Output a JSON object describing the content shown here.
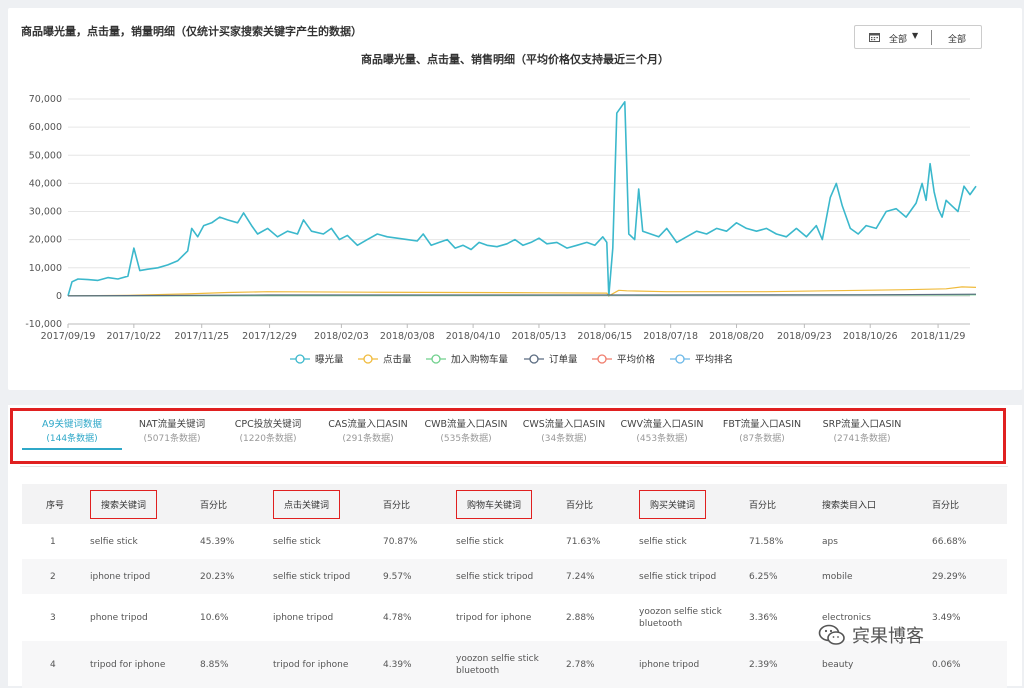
{
  "panel": {
    "title": "商品曝光量，点击量，销量明细（仅统计买家搜索关键字产生的数据）",
    "date_picker": {
      "value": "全部",
      "value2": "全部"
    }
  },
  "chart_data": {
    "type": "line",
    "title": "商品曝光量、点击量、销售明细（平均价格仅支持最近三个月）",
    "x_ticks": [
      "2017/09/19",
      "2017/10/22",
      "2017/11/25",
      "2017/12/29",
      "2018/02/03",
      "2018/03/08",
      "2018/04/10",
      "2018/05/13",
      "2018/06/15",
      "2018/07/18",
      "2018/08/20",
      "2018/09/23",
      "2018/10/26",
      "2018/11/29"
    ],
    "x_range": [
      "2017/09/19",
      "2018/12/15"
    ],
    "y_ticks": [
      "70,000",
      "60,000",
      "50,000",
      "40,000",
      "30,000",
      "20,000",
      "10,000",
      "0",
      "-10,000"
    ],
    "ylim": [
      -10000,
      70000
    ],
    "grid": true,
    "legend_position": "bottom",
    "series": [
      {
        "name": "曝光量",
        "color": "#3bb8cc",
        "points": [
          [
            0,
            0
          ],
          [
            2,
            5000
          ],
          [
            5,
            6000
          ],
          [
            10,
            5800
          ],
          [
            15,
            5500
          ],
          [
            20,
            6500
          ],
          [
            25,
            6000
          ],
          [
            30,
            7000
          ],
          [
            33,
            17000
          ],
          [
            36,
            9000
          ],
          [
            40,
            9500
          ],
          [
            45,
            10000
          ],
          [
            50,
            11000
          ],
          [
            55,
            12500
          ],
          [
            60,
            16000
          ],
          [
            62,
            24000
          ],
          [
            65,
            21000
          ],
          [
            68,
            25000
          ],
          [
            72,
            26000
          ],
          [
            76,
            28000
          ],
          [
            80,
            27000
          ],
          [
            85,
            26000
          ],
          [
            88,
            29500
          ],
          [
            92,
            25000
          ],
          [
            95,
            22000
          ],
          [
            100,
            24000
          ],
          [
            105,
            21000
          ],
          [
            110,
            23000
          ],
          [
            115,
            22000
          ],
          [
            118,
            27000
          ],
          [
            122,
            23000
          ],
          [
            128,
            22000
          ],
          [
            132,
            24000
          ],
          [
            136,
            20000
          ],
          [
            140,
            21500
          ],
          [
            145,
            18000
          ],
          [
            150,
            20000
          ],
          [
            155,
            22000
          ],
          [
            160,
            21000
          ],
          [
            165,
            20500
          ],
          [
            170,
            20000
          ],
          [
            175,
            19500
          ],
          [
            178,
            22000
          ],
          [
            182,
            18000
          ],
          [
            186,
            19000
          ],
          [
            190,
            20000
          ],
          [
            194,
            17000
          ],
          [
            198,
            18000
          ],
          [
            202,
            16500
          ],
          [
            206,
            19000
          ],
          [
            210,
            18000
          ],
          [
            215,
            17500
          ],
          [
            220,
            18500
          ],
          [
            224,
            20000
          ],
          [
            228,
            18000
          ],
          [
            232,
            19000
          ],
          [
            236,
            20500
          ],
          [
            240,
            18500
          ],
          [
            245,
            19000
          ],
          [
            250,
            17000
          ],
          [
            255,
            18000
          ],
          [
            260,
            19000
          ],
          [
            264,
            18000
          ],
          [
            268,
            21000
          ],
          [
            270,
            19000
          ],
          [
            271,
            0
          ],
          [
            273,
            17000
          ],
          [
            275,
            65000
          ],
          [
            277,
            67000
          ],
          [
            279,
            69000
          ],
          [
            281,
            22000
          ],
          [
            284,
            20000
          ],
          [
            286,
            38000
          ],
          [
            288,
            23000
          ],
          [
            292,
            22000
          ],
          [
            296,
            21000
          ],
          [
            300,
            24000
          ],
          [
            305,
            19000
          ],
          [
            310,
            21000
          ],
          [
            315,
            23000
          ],
          [
            320,
            22000
          ],
          [
            325,
            24000
          ],
          [
            330,
            23000
          ],
          [
            335,
            26000
          ],
          [
            340,
            24000
          ],
          [
            345,
            23000
          ],
          [
            350,
            24000
          ],
          [
            355,
            22000
          ],
          [
            360,
            21000
          ],
          [
            365,
            24000
          ],
          [
            370,
            21000
          ],
          [
            375,
            25000
          ],
          [
            378,
            20000
          ],
          [
            382,
            35000
          ],
          [
            385,
            40000
          ],
          [
            388,
            32000
          ],
          [
            392,
            24000
          ],
          [
            396,
            22000
          ],
          [
            400,
            25000
          ],
          [
            405,
            24000
          ],
          [
            410,
            30000
          ],
          [
            415,
            31000
          ],
          [
            420,
            28000
          ],
          [
            425,
            33000
          ],
          [
            428,
            40000
          ],
          [
            430,
            34000
          ],
          [
            432,
            47000
          ],
          [
            434,
            37000
          ],
          [
            436,
            31000
          ],
          [
            438,
            28000
          ],
          [
            440,
            34000
          ],
          [
            443,
            32000
          ],
          [
            446,
            30000
          ],
          [
            449,
            39000
          ],
          [
            452,
            36000
          ],
          [
            454,
            38000
          ],
          [
            455,
            39000
          ]
        ]
      },
      {
        "name": "点击量",
        "color": "#f0bb3c",
        "points": [
          [
            0,
            0
          ],
          [
            30,
            200
          ],
          [
            60,
            700
          ],
          [
            80,
            1200
          ],
          [
            100,
            1500
          ],
          [
            150,
            1300
          ],
          [
            200,
            1200
          ],
          [
            240,
            1100
          ],
          [
            270,
            1000
          ],
          [
            271,
            0
          ],
          [
            276,
            2000
          ],
          [
            280,
            1800
          ],
          [
            300,
            1500
          ],
          [
            350,
            1500
          ],
          [
            380,
            1800
          ],
          [
            420,
            2200
          ],
          [
            440,
            2500
          ],
          [
            448,
            3200
          ],
          [
            455,
            3000
          ]
        ]
      },
      {
        "name": "加入购物车量",
        "color": "#6fd08c",
        "points": [
          [
            0,
            0
          ],
          [
            455,
            400
          ]
        ]
      },
      {
        "name": "订单量",
        "color": "#5a6b80",
        "points": [
          [
            0,
            0
          ],
          [
            100,
            300
          ],
          [
            200,
            300
          ],
          [
            300,
            300
          ],
          [
            400,
            400
          ],
          [
            455,
            600
          ]
        ]
      },
      {
        "name": "平均价格",
        "color": "#f07c6c",
        "points": []
      },
      {
        "name": "平均排名",
        "color": "#6bb8e8",
        "points": []
      }
    ]
  },
  "tabs": [
    {
      "label": "A9关键词数据",
      "sub": "(144条数据)"
    },
    {
      "label": "NAT流量关键词",
      "sub": "(5071条数据)"
    },
    {
      "label": "CPC投放关键词",
      "sub": "(1220条数据)"
    },
    {
      "label": "CAS流量入口ASIN",
      "sub": "(291条数据)"
    },
    {
      "label": "CWB流量入口ASIN",
      "sub": "(535条数据)"
    },
    {
      "label": "CWS流量入口ASIN",
      "sub": "(34条数据)"
    },
    {
      "label": "CWV流量入口ASIN",
      "sub": "(453条数据)"
    },
    {
      "label": "FBT流量入口ASIN",
      "sub": "(87条数据)"
    },
    {
      "label": "SRP流量入口ASIN",
      "sub": "(2741条数据)"
    }
  ],
  "table": {
    "headers": [
      "序号",
      "搜索关键词",
      "百分比",
      "点击关键词",
      "百分比",
      "购物车关键词",
      "百分比",
      "购买关键词",
      "百分比",
      "搜索类目入口",
      "百分比"
    ],
    "rows": [
      [
        "1",
        "selfie stick",
        "45.39%",
        "selfie stick",
        "70.87%",
        "selfie stick",
        "71.63%",
        "selfie stick",
        "71.58%",
        "aps",
        "66.68%"
      ],
      [
        "2",
        "iphone tripod",
        "20.23%",
        "selfie stick tripod",
        "9.57%",
        "selfie stick tripod",
        "7.24%",
        "selfie stick tripod",
        "6.25%",
        "mobile",
        "29.29%"
      ],
      [
        "3",
        "phone tripod",
        "10.6%",
        "iphone tripod",
        "4.78%",
        "tripod for iphone",
        "2.88%",
        "yoozon selfie stick bluetooth",
        "3.36%",
        "electronics",
        "3.49%"
      ],
      [
        "4",
        "tripod for iphone",
        "8.85%",
        "tripod for iphone",
        "4.39%",
        "yoozon selfie stick bluetooth",
        "2.78%",
        "iphone tripod",
        "2.39%",
        "beauty",
        "0.06%"
      ]
    ]
  },
  "watermark": {
    "text": "宾果博客"
  }
}
